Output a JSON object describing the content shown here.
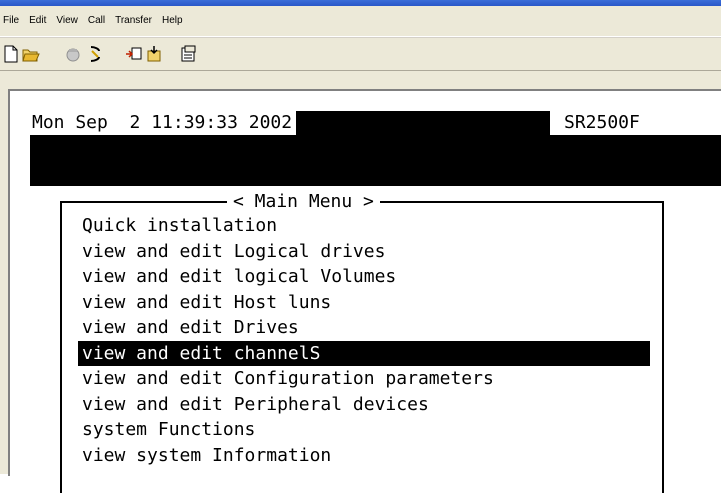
{
  "menubar": {
    "items": [
      "File",
      "Edit",
      "View",
      "Call",
      "Transfer",
      "Help"
    ]
  },
  "toolbar": {
    "buttons": [
      "new-icon",
      "open-icon",
      "disconnect-icon",
      "connect-icon",
      "send-icon",
      "receive-icon",
      "properties-icon"
    ]
  },
  "terminal": {
    "datetime": "Mon Sep  2 11:39:33 2002",
    "model": "SR2500F",
    "menu_title": "< Main Menu >",
    "items": [
      "Quick installation",
      "view and edit Logical drives",
      "view and edit logical Volumes",
      "view and edit Host luns",
      "view and edit Drives",
      "view and edit channelS",
      "view and edit Configuration parameters",
      "view and edit Peripheral devices",
      "system Functions",
      "view system Information"
    ],
    "selected_index": 5
  }
}
